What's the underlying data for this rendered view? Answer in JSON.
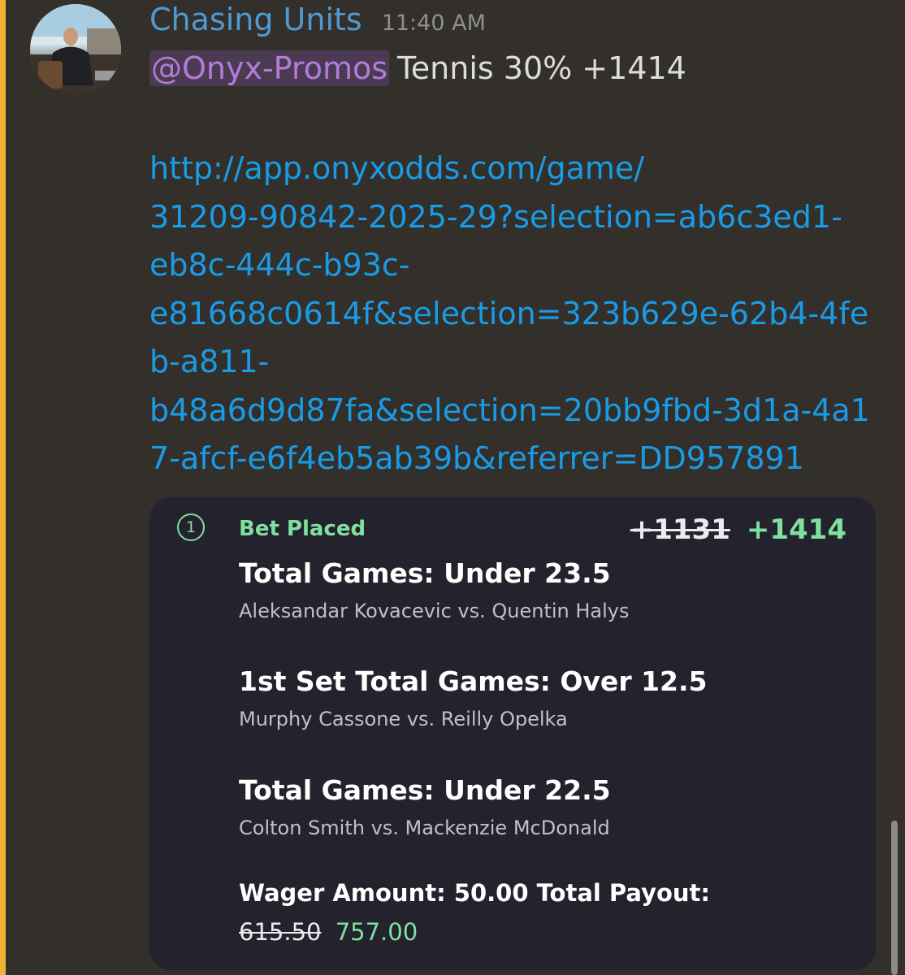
{
  "message": {
    "author": "Chasing Units",
    "timestamp": "11:40 AM",
    "mention": "@Onyx-Promos",
    "text": "Tennis 30% +1414",
    "link_lines": [
      "http://app.onyxodds.com/game/",
      "31209-90842-2025-29?selection=ab6c3ed1-",
      "eb8c-444c-b93c-",
      "e81668c0614f&selection=323b629e-62b4-4fe",
      "b-a811-",
      "b48a6d9d87fa&selection=20bb9fbd-3d1a-4a1",
      "7-afcf-e6f4eb5ab39b&referrer=DD957891"
    ]
  },
  "bet_card": {
    "leg_count": "1",
    "status": "Bet Placed",
    "old_odds": "+1131",
    "new_odds": "+1414",
    "legs": [
      {
        "title": "Total Games: Under 23.5",
        "match": "Aleksandar Kovacevic vs. Quentin Halys"
      },
      {
        "title": "1st Set Total Games: Over 12.5",
        "match": "Murphy Cassone vs. Reilly Opelka"
      },
      {
        "title": "Total Games: Under 22.5",
        "match": "Colton Smith vs. Mackenzie McDonald"
      }
    ],
    "wager_text": "Wager Amount: 50.00 Total Payout:",
    "old_payout": "615.50",
    "new_payout": "757.00"
  },
  "colors": {
    "background": "#332f2a",
    "author": "#4e9bd4",
    "mention": "#b57bd9",
    "link": "#1a9be6",
    "success": "#7fe0a0",
    "card": "#24222c",
    "highlight": "#f0b232"
  }
}
